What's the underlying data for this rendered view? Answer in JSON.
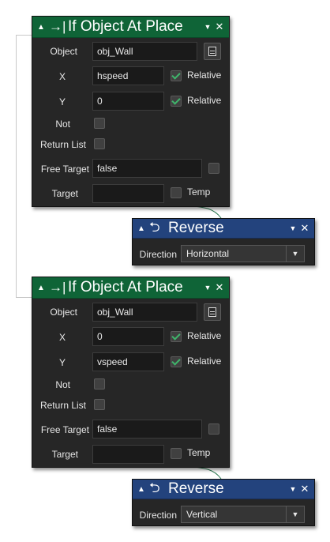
{
  "blocks": [
    {
      "title": "If Object At Place",
      "object_label": "Object",
      "object_value": "obj_Wall",
      "x_label": "X",
      "x_value": "hspeed",
      "x_relative_label": "Relative",
      "y_label": "Y",
      "y_value": "0",
      "y_relative_label": "Relative",
      "not_label": "Not",
      "return_list_label": "Return List",
      "free_target_label": "Free Target",
      "free_target_value": "false",
      "target_label": "Target",
      "target_value": "",
      "temp_label": "Temp",
      "reverse": {
        "title": "Reverse",
        "direction_label": "Direction",
        "direction_value": "Horizontal"
      }
    },
    {
      "title": "If Object At Place",
      "object_label": "Object",
      "object_value": "obj_Wall",
      "x_label": "X",
      "x_value": "0",
      "x_relative_label": "Relative",
      "y_label": "Y",
      "y_value": "vspeed",
      "y_relative_label": "Relative",
      "not_label": "Not",
      "return_list_label": "Return List",
      "free_target_label": "Free Target",
      "free_target_value": "false",
      "target_label": "Target",
      "target_value": "",
      "temp_label": "Temp",
      "reverse": {
        "title": "Reverse",
        "direction_label": "Direction",
        "direction_value": "Vertical"
      }
    }
  ],
  "icons": {
    "collapse": "▲",
    "if_icon": "→|",
    "reverse_icon": "⮌",
    "menu": "▼",
    "close": "✕",
    "dropdown": "▼"
  },
  "colors": {
    "if_header": "#0f6437",
    "reverse_header": "#23437d",
    "panel_bg": "#262626",
    "check_green": "#3fb56b"
  }
}
